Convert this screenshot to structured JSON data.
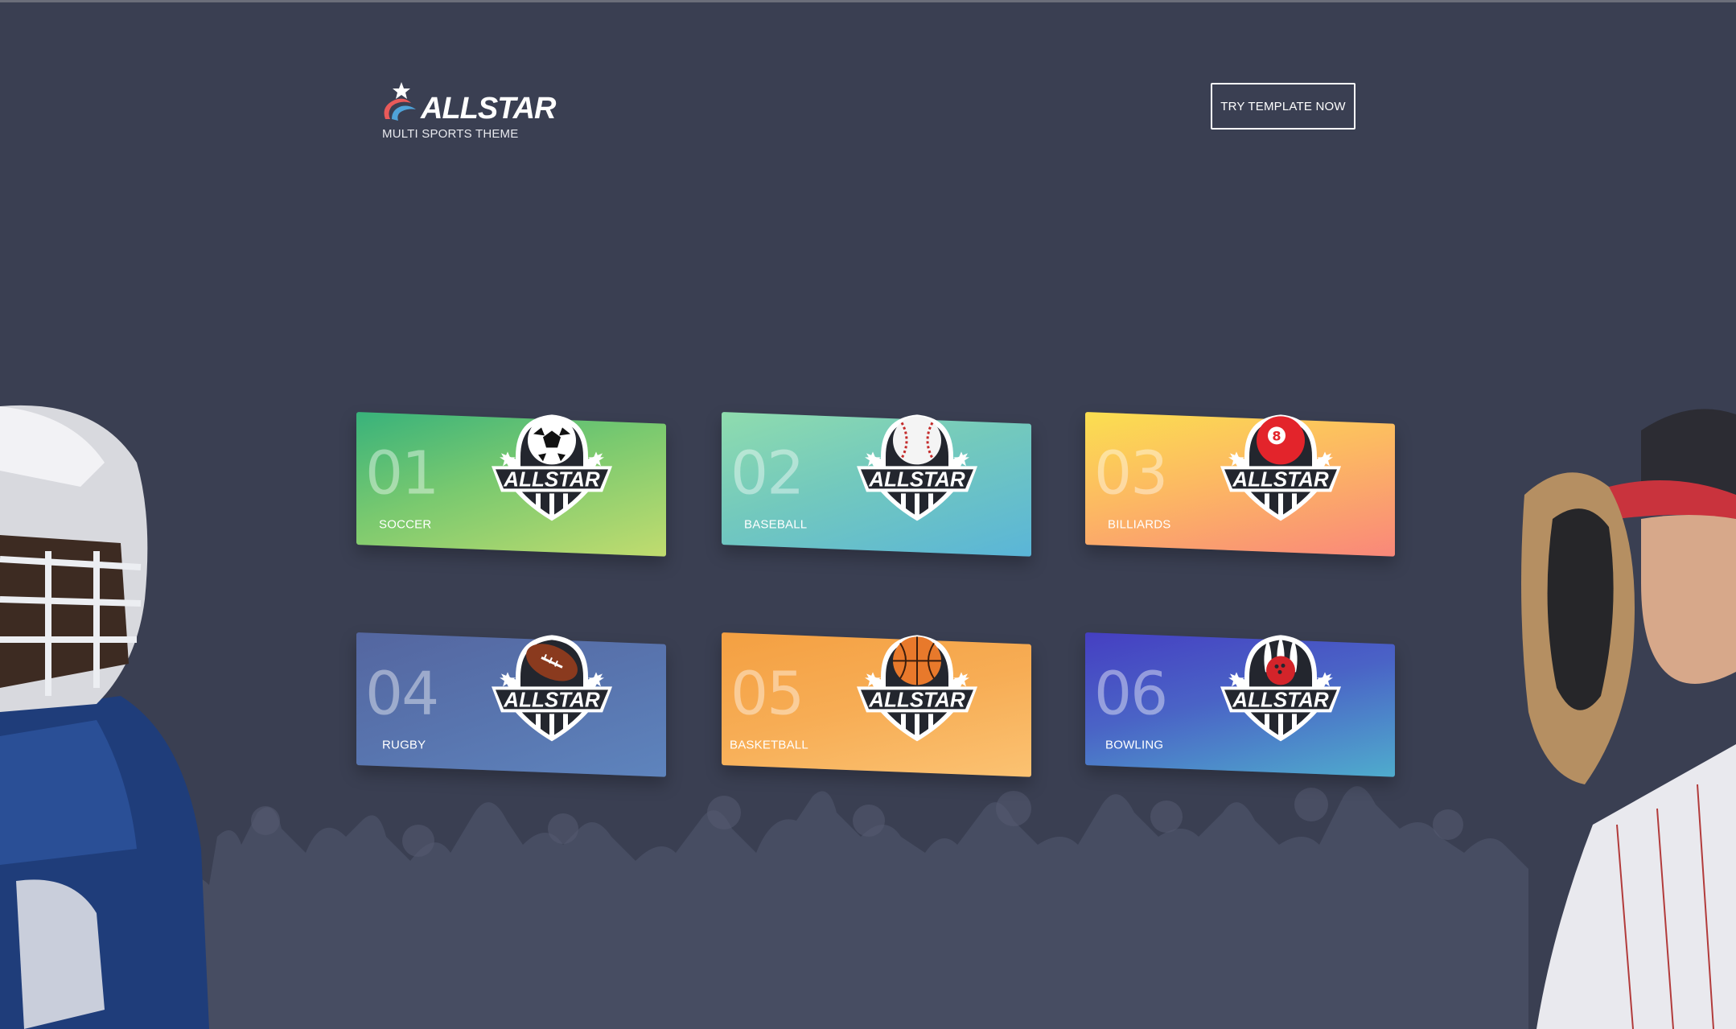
{
  "header": {
    "brand_name": "ALLSTAR",
    "tagline": "MULTI SPORTS THEME",
    "cta_label": "TRY TEMPLATE NOW"
  },
  "badge_text": "ALLSTAR",
  "cards": [
    {
      "number": "01",
      "label": "SOCCER",
      "icon": "soccer-ball-icon"
    },
    {
      "number": "02",
      "label": "BASEBALL",
      "icon": "baseball-icon"
    },
    {
      "number": "03",
      "label": "BILLIARDS",
      "icon": "billiard-ball-8-icon"
    },
    {
      "number": "04",
      "label": "RUGBY",
      "icon": "rugby-ball-icon"
    },
    {
      "number": "05",
      "label": "BASKETBALL",
      "icon": "basketball-icon"
    },
    {
      "number": "06",
      "label": "BOWLING",
      "icon": "bowling-pins-icon"
    }
  ],
  "colors": {
    "background": "#3a3f52",
    "card_soccer": "#38b27b",
    "card_baseball": "#73c9bd",
    "card_billiards": "#fcb962",
    "card_rugby": "#5874ae",
    "card_basketball": "#f7ad55",
    "card_bowling": "#4a63c6"
  }
}
